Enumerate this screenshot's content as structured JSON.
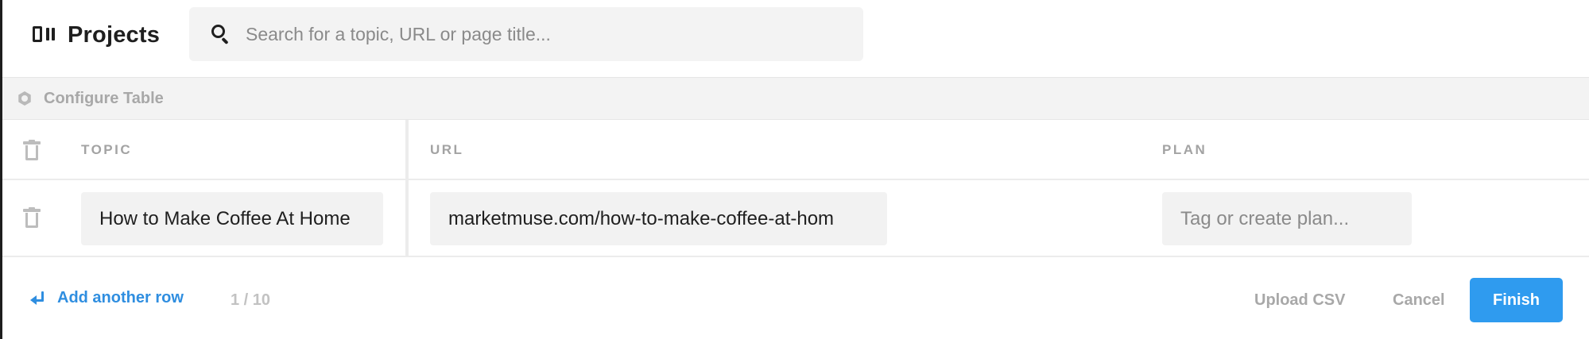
{
  "header": {
    "title": "Projects",
    "search_placeholder": "Search for a topic, URL or page title..."
  },
  "toolbar": {
    "configure_label": "Configure Table"
  },
  "table": {
    "columns": [
      "TOPIC",
      "URL",
      "PLAN"
    ],
    "rows": [
      {
        "topic": "How to Make Coffee At Home",
        "url": "marketmuse.com/how-to-make-coffee-at-hom",
        "plan_placeholder": "Tag or create plan..."
      }
    ]
  },
  "footer": {
    "add_row_label": "Add another row",
    "counter": "1 / 10",
    "upload_label": "Upload CSV",
    "cancel_label": "Cancel",
    "finish_label": "Finish"
  },
  "colors": {
    "accent": "#2f8ee0",
    "finish_bg": "#2f9bef",
    "muted_text": "#a8a8a8",
    "field_bg": "#f2f2f2"
  },
  "icons": {
    "brand": "kanban-icon",
    "search": "search-icon",
    "configure": "settings-hex-icon",
    "delete": "trash-icon",
    "add_row": "return-arrow-icon"
  }
}
